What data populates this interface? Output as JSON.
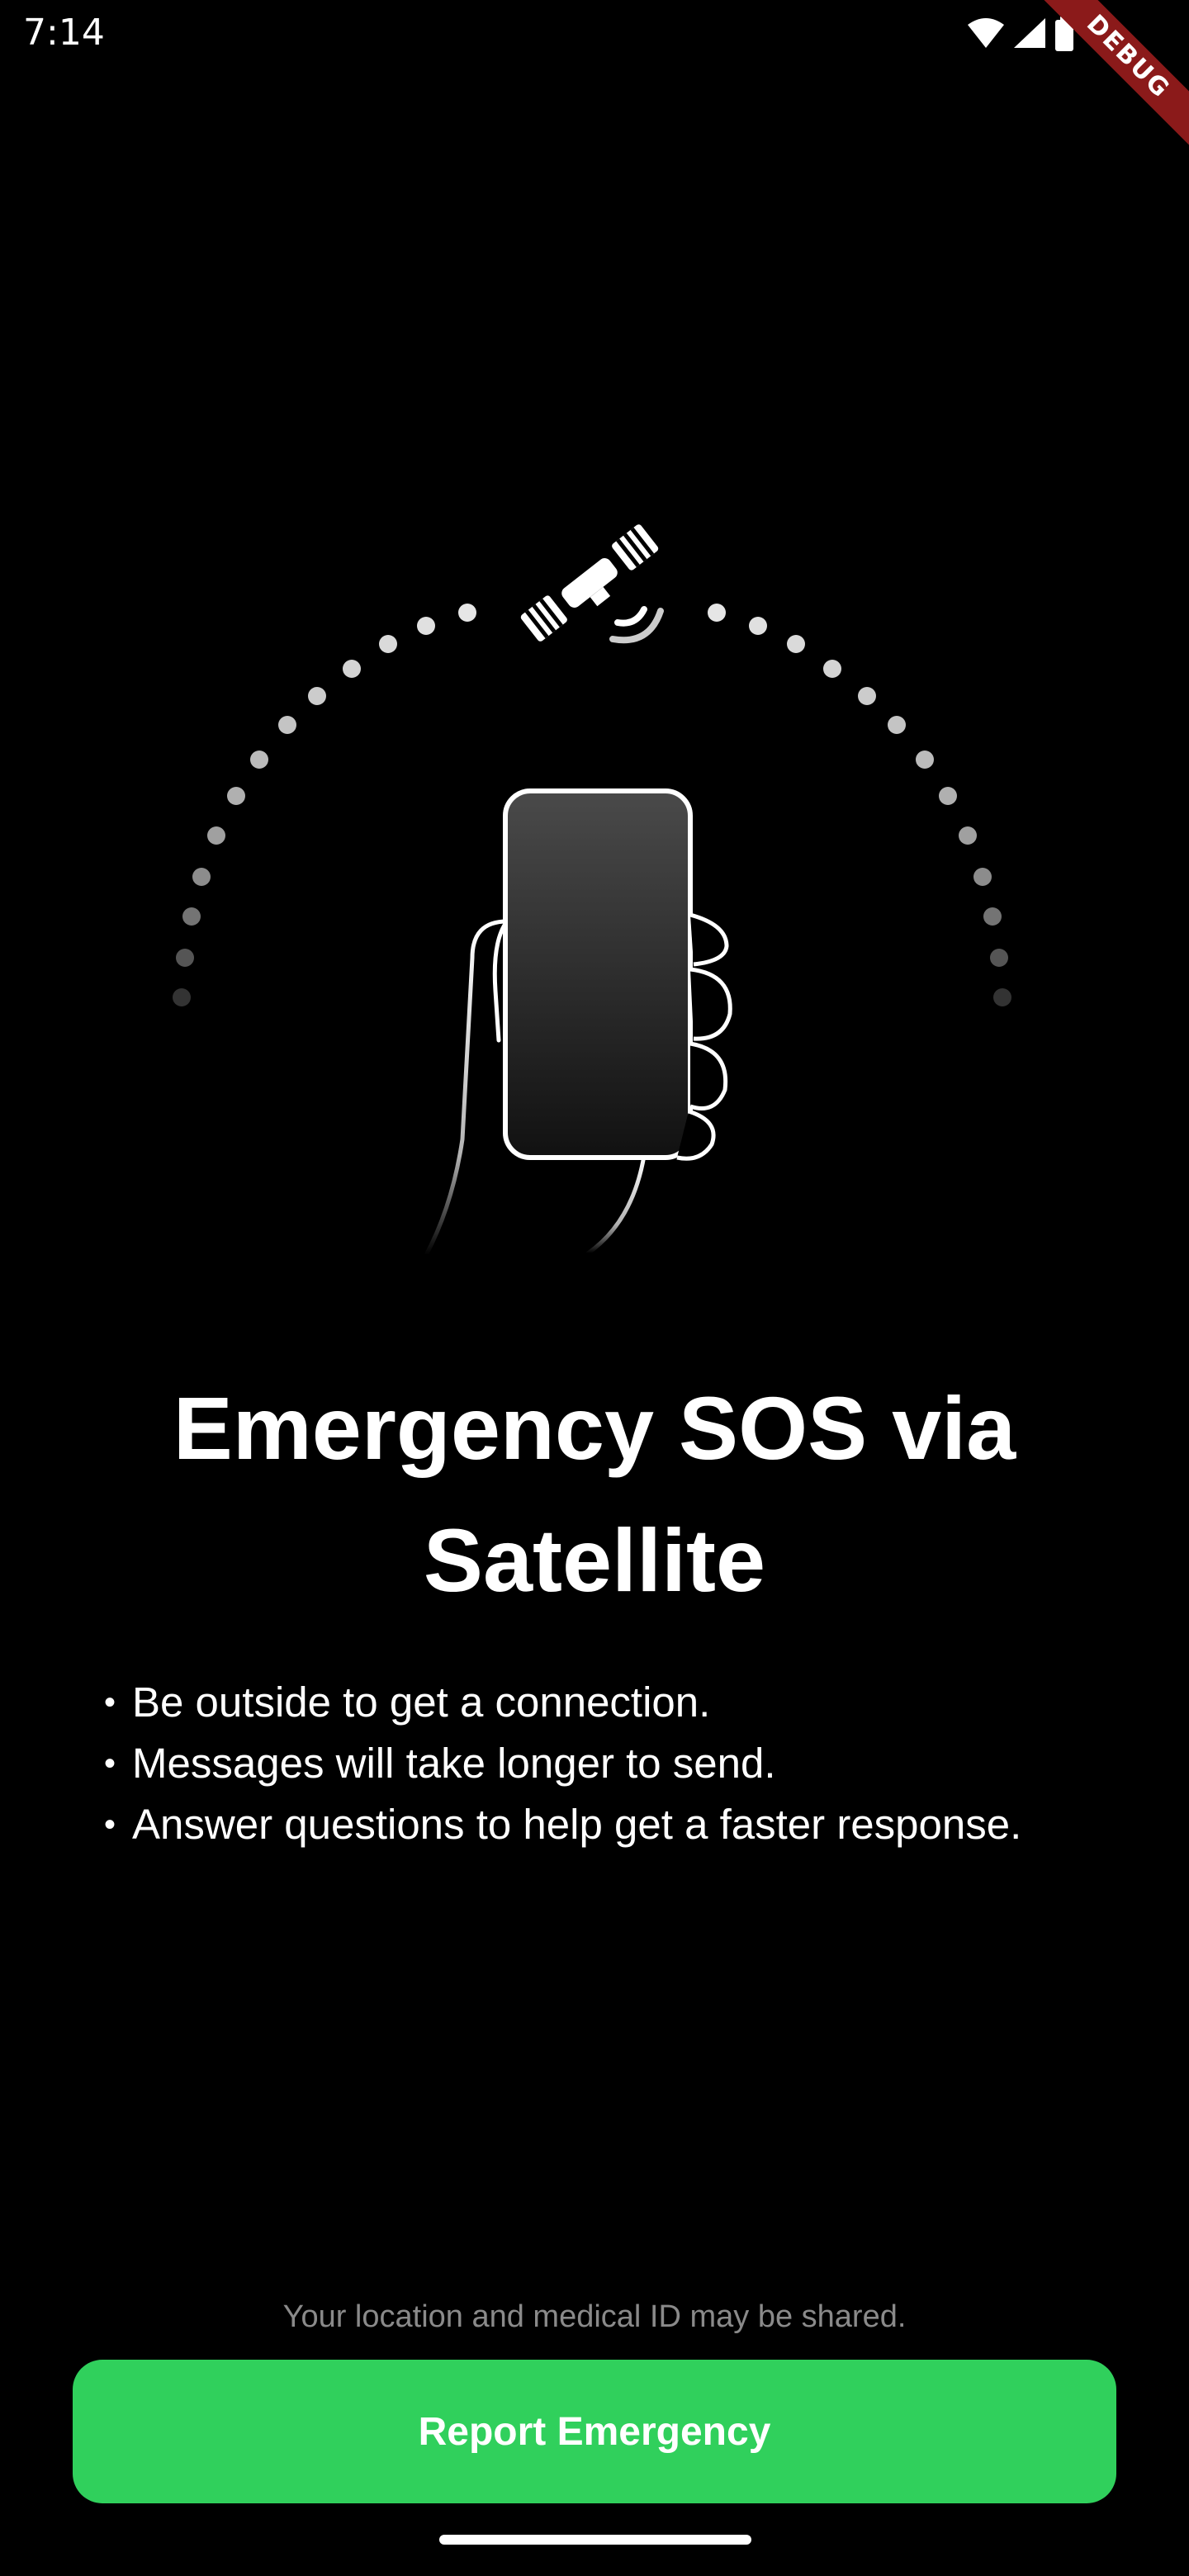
{
  "status_bar": {
    "time": "7:14",
    "icons": [
      "wifi-icon",
      "signal-icon",
      "battery-icon"
    ]
  },
  "debug_banner": {
    "label": "DEBUG"
  },
  "illustration": {
    "icons": [
      "satellite-icon",
      "phone-in-hand-icon"
    ]
  },
  "page": {
    "title": "Emergency SOS via Satellite",
    "bullets": [
      "Be outside to get a connection.",
      "Messages will take longer to send.",
      "Answer questions to help get a faster response."
    ],
    "disclaimer": "Your location and medical ID may be shared."
  },
  "actions": {
    "report_label": "Report Emergency"
  },
  "colors": {
    "background": "#000000",
    "accent_green": "#30d05c",
    "debug_red": "#8b1a1a",
    "disclaimer_gray": "#8a8a8a"
  }
}
